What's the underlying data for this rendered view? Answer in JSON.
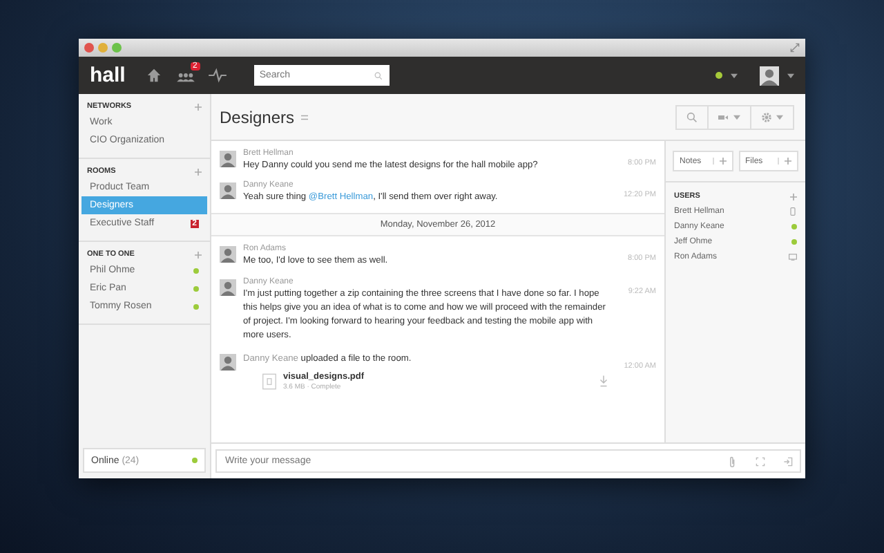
{
  "topbar": {
    "logo": "hall",
    "nav": [
      {
        "kind": "home"
      },
      {
        "kind": "people",
        "badge": "2"
      },
      {
        "kind": "activity"
      }
    ],
    "search": {
      "placeholder": "Search"
    }
  },
  "sidebar": {
    "sections": [
      {
        "title": "NETWORKS",
        "items": [
          {
            "label": "Work",
            "selected": false,
            "online": false
          },
          {
            "label": "CIO Organization",
            "selected": false,
            "online": false
          }
        ]
      },
      {
        "title": "ROOMS",
        "items": [
          {
            "label": "Product Team",
            "selected": false,
            "online": false
          },
          {
            "label": "Designers",
            "selected": true,
            "online": false
          },
          {
            "label": "Executive Staff",
            "selected": false,
            "online": false,
            "badge": "2"
          }
        ]
      },
      {
        "title": "ONE TO ONE",
        "items": [
          {
            "label": "Phil Ohme",
            "selected": false,
            "online": true
          },
          {
            "label": "Eric Pan",
            "selected": false,
            "online": true
          },
          {
            "label": "Tommy Rosen",
            "selected": false,
            "online": true
          }
        ]
      }
    ],
    "online": {
      "label": "Online",
      "count": "(24)"
    }
  },
  "room": {
    "title": "Designers"
  },
  "messages": [
    {
      "kind": "message",
      "author": "Brett Hellman",
      "time": "8:00 PM",
      "parts": [
        {
          "kind": "plain",
          "text": "Hey Danny could you send me the latest designs for the hall mobile app?"
        }
      ]
    },
    {
      "kind": "message",
      "author": "Danny Keane",
      "time": "12:20 PM",
      "parts": [
        {
          "kind": "plain",
          "text": "Yeah sure thing "
        },
        {
          "kind": "mention",
          "text": "@Brett Hellman"
        },
        {
          "kind": "plain",
          "text": ", I'll send them over right away."
        }
      ]
    },
    {
      "kind": "date",
      "text": "Monday, November 26, 2012"
    },
    {
      "kind": "message",
      "author": "Ron Adams",
      "time": "8:00 PM",
      "parts": [
        {
          "kind": "plain",
          "text": "Me too, I'd love to see them as well."
        }
      ]
    },
    {
      "kind": "message",
      "author": "Danny Keane",
      "time": "9:22 AM",
      "parts": [
        {
          "kind": "plain",
          "text": "I'm just putting together a zip containing the three screens that I have done so far. I hope this helps give you an idea of what is to come and how we will proceed with the remainder of project. I'm looking forward to hearing your feedback and testing the mobile app with more users."
        }
      ]
    },
    {
      "kind": "upload",
      "author": "Danny Keane",
      "text": "uploaded a file to the room.",
      "time": "12:00 AM",
      "file": {
        "name": "visual_designs.pdf",
        "meta": "3.6 MB · Complete"
      }
    }
  ],
  "panel": {
    "buttons": [
      {
        "label": "Notes"
      },
      {
        "label": "Files"
      }
    ],
    "users_title": "USERS",
    "users": [
      {
        "name": "Brett Hellman",
        "kind": "mobile"
      },
      {
        "name": "Danny Keane",
        "kind": "online"
      },
      {
        "name": "Jeff Ohme",
        "kind": "online"
      },
      {
        "name": "Ron Adams",
        "kind": "desktop"
      }
    ]
  },
  "composer": {
    "placeholder": "Write your message"
  }
}
